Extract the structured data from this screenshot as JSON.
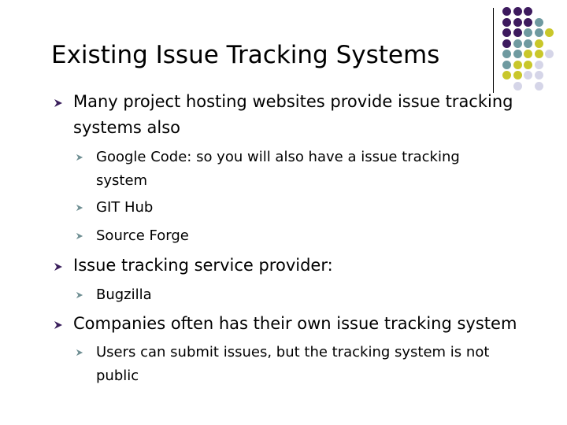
{
  "slide": {
    "title": "Existing Issue Tracking Systems",
    "colors": {
      "primary_bullet": "#3a1f5c",
      "secondary_bullet": "#6f8f93",
      "decor_purple": "#3d1a5e",
      "decor_teal": "#6f9aa0",
      "decor_yellow": "#c9c72a",
      "decor_lavender": "#d5d5e8"
    },
    "bullets": [
      {
        "text_line1": "Many project hosting websites provide issue tracking",
        "text_line2": "systems also",
        "icon": "arrowhead-bullet-icon",
        "children": [
          {
            "text_line1": "Google Code: so you will also have a issue tracking",
            "text_line2": "system",
            "icon": "arrowhead-bullet-icon"
          },
          {
            "text_line1": "GIT Hub",
            "icon": "arrowhead-bullet-icon"
          },
          {
            "text_line1": "Source Forge",
            "icon": "arrowhead-bullet-icon"
          }
        ]
      },
      {
        "text_line1": "Issue tracking service provider:",
        "icon": "arrowhead-bullet-icon",
        "children": [
          {
            "text_line1": "Bugzilla",
            "icon": "arrowhead-bullet-icon"
          }
        ]
      },
      {
        "text_line1": "Companies often has their own issue tracking system",
        "icon": "arrowhead-bullet-icon",
        "children": [
          {
            "text_line1": "Users can submit issues, but the tracking system is not",
            "text_line2": "public",
            "icon": "arrowhead-bullet-icon"
          }
        ]
      }
    ],
    "decoration": {
      "icon": "dot-grid-decoration",
      "grid": [
        [
          "P",
          "P",
          "P",
          "",
          ""
        ],
        [
          "P",
          "P",
          "P",
          "T",
          ""
        ],
        [
          "P",
          "P",
          "T",
          "T",
          "Y"
        ],
        [
          "P",
          "T",
          "T",
          "Y",
          ""
        ],
        [
          "T",
          "T",
          "Y",
          "Y",
          "L"
        ],
        [
          "T",
          "Y",
          "Y",
          "L",
          ""
        ],
        [
          "Y",
          "Y",
          "L",
          "L",
          ""
        ],
        [
          "",
          "L",
          "",
          "L",
          ""
        ]
      ]
    }
  }
}
